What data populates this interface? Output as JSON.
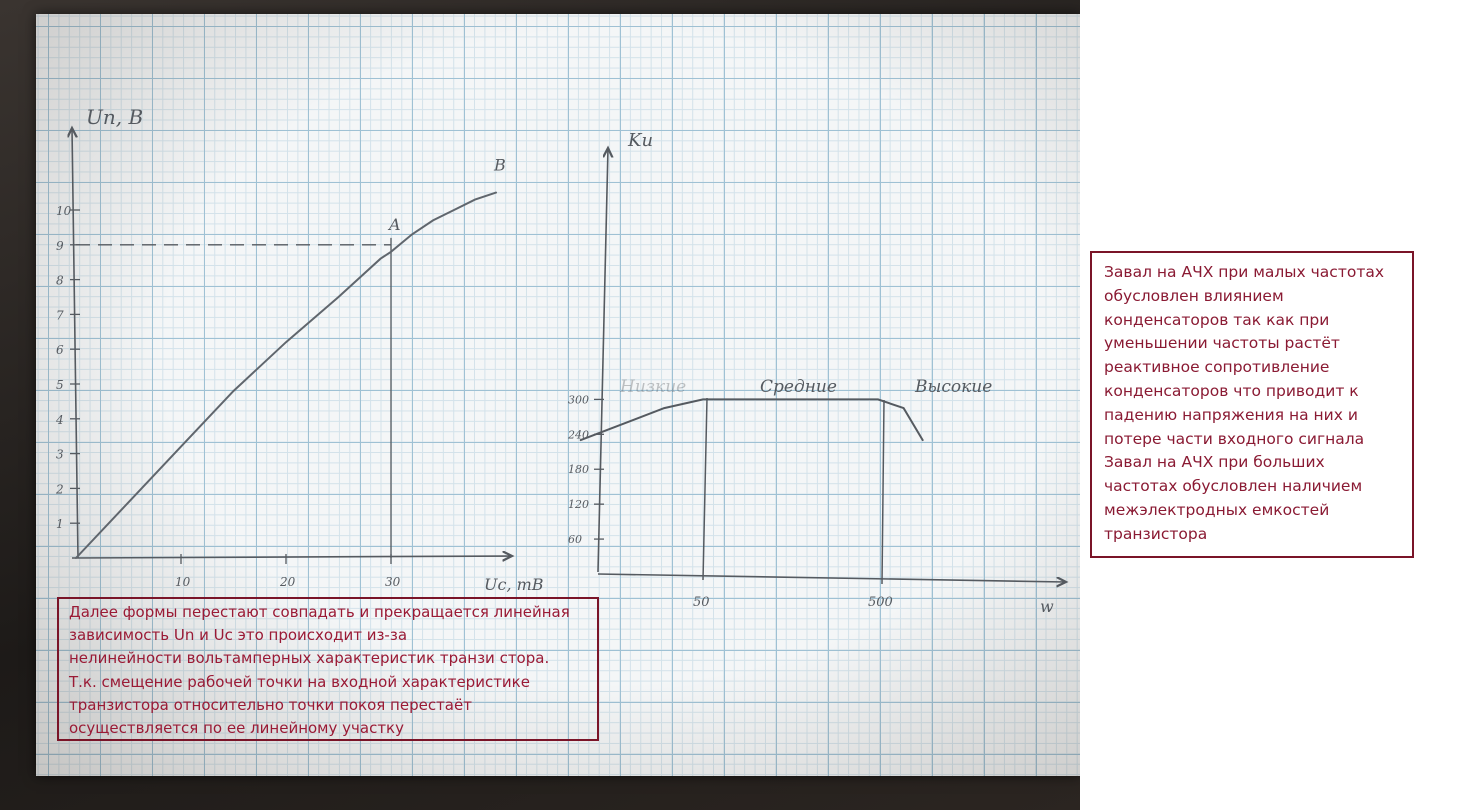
{
  "notes": {
    "right": "Завал на АЧХ при малых частотах\nобусловлен влиянием\nконденсаторов так как при\nуменьшении частоты растёт\nреактивное сопротивление\nконденсаторов что приводит к\nпадению напряжения на них и\nпотере части входного сигнала\nЗавал на АЧХ при больших\nчастотах обусловлен наличием\nмежэлектродных емкостей\nтранзистора",
    "bottom": "Далее формы перестают совпадать и прекращается линейная\nзависимость Un и Uc это происходит из-за\nнелинейности вольтамперных характеристик транзи стора.\nТ.к. смещение рабочей точки на входной характеристике\nтранзистора относительно точки покоя перестаёт\nосуществляется по ее линейному участку"
  },
  "colors": {
    "annotation_border": "#7a1428",
    "annotation_text": "#8a1a33",
    "pencil": "#555a60",
    "grid_major": "#9fc1d4",
    "grid_minor": "#d3e2ea"
  },
  "chart_data": [
    {
      "type": "line",
      "ylabel": "Uп, В",
      "xlabel": "Uс, mB",
      "x_ticks": [
        "10",
        "20",
        "30"
      ],
      "y_ticks": [
        "1",
        "2",
        "3",
        "4",
        "5",
        "6",
        "7",
        "8",
        "9",
        "10"
      ],
      "xlim": [
        0,
        40
      ],
      "ylim": [
        0,
        12
      ],
      "series": [
        {
          "x": [
            0,
            5,
            10,
            15,
            20,
            25,
            29,
            30,
            32,
            34,
            36,
            38,
            40
          ],
          "y": [
            0,
            1.6,
            3.2,
            4.8,
            6.2,
            7.5,
            8.6,
            8.8,
            9.3,
            9.7,
            10.0,
            10.3,
            10.5
          ]
        }
      ],
      "points": [
        {
          "label": "A",
          "x": 30,
          "y": 8.8
        },
        {
          "label": "B",
          "x": 40,
          "y": 10.5
        }
      ],
      "reference_lines": [
        {
          "axis": "y",
          "value": 9
        },
        {
          "axis": "x",
          "value": 30
        }
      ]
    },
    {
      "type": "line",
      "ylabel": "Kи",
      "xlabel": "w",
      "x_ticks": [
        "50",
        "500"
      ],
      "y_ticks": [
        "60",
        "120",
        "180",
        "240",
        "300"
      ],
      "region_labels": [
        "Низкие",
        "Средние",
        "Высокие"
      ],
      "series": [
        {
          "x": [
            10,
            30,
            50,
            500,
            700,
            900
          ],
          "y": [
            230,
            285,
            300,
            300,
            285,
            230
          ]
        }
      ]
    }
  ]
}
